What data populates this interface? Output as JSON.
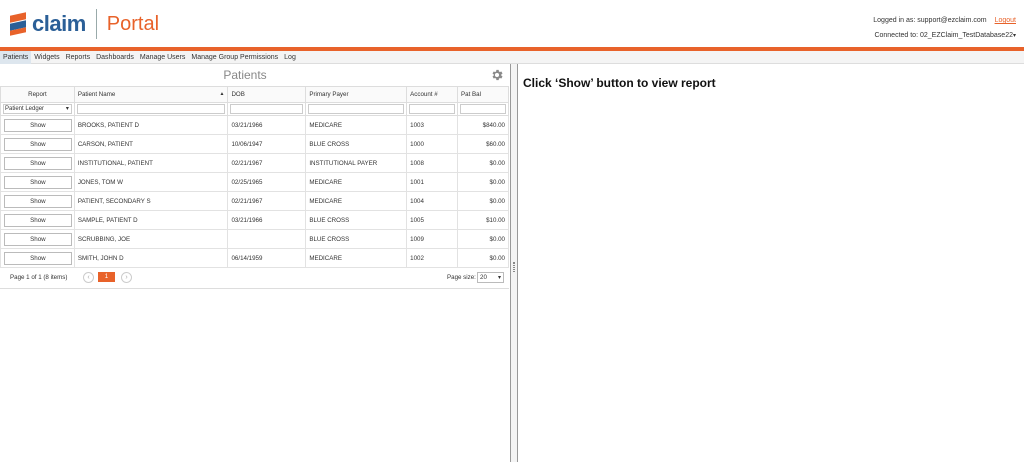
{
  "header": {
    "logo_text": "claim",
    "portal_label": "Portal",
    "logged_in_label": "Logged in as:",
    "logged_in_user": "support@ezclaim.com",
    "logout_label": "Logout",
    "connected_label": "Connected to:",
    "connected_db": "02_EZClaim_TestDatabase22"
  },
  "nav": {
    "items": [
      {
        "label": "Patients"
      },
      {
        "label": "Widgets"
      },
      {
        "label": "Reports"
      },
      {
        "label": "Dashboards"
      },
      {
        "label": "Manage Users"
      },
      {
        "label": "Manage Group Permissions"
      },
      {
        "label": "Log"
      }
    ]
  },
  "patients": {
    "title": "Patients",
    "columns": [
      "Report",
      "Patient Name",
      "DOB",
      "Primary Payer",
      "Account #",
      "Pat Bal"
    ],
    "report_filter": "Patient Ledger",
    "show_label": "Show",
    "rows": [
      {
        "name": "BROOKS, PATIENT D",
        "dob": "03/21/1966",
        "payer": "MEDICARE",
        "account": "1003",
        "bal": "$840.00"
      },
      {
        "name": "CARSON, PATIENT",
        "dob": "10/06/1947",
        "payer": "BLUE CROSS",
        "account": "1000",
        "bal": "$60.00"
      },
      {
        "name": "INSTITUTIONAL, PATIENT",
        "dob": "02/21/1967",
        "payer": "INSTITUTIONAL PAYER",
        "account": "1008",
        "bal": "$0.00"
      },
      {
        "name": "JONES, TOM W",
        "dob": "02/25/1965",
        "payer": "MEDICARE",
        "account": "1001",
        "bal": "$0.00"
      },
      {
        "name": "PATIENT, SECONDARY S",
        "dob": "02/21/1967",
        "payer": "MEDICARE",
        "account": "1004",
        "bal": "$0.00"
      },
      {
        "name": "SAMPLE, PATIENT D",
        "dob": "03/21/1966",
        "payer": "BLUE CROSS",
        "account": "1005",
        "bal": "$10.00"
      },
      {
        "name": "SCRUBBING, JOE",
        "dob": "",
        "payer": "BLUE CROSS",
        "account": "1009",
        "bal": "$0.00"
      },
      {
        "name": "SMITH, JOHN D",
        "dob": "06/14/1959",
        "payer": "MEDICARE",
        "account": "1002",
        "bal": "$0.00"
      }
    ],
    "pager": {
      "info": "Page 1 of 1 (8 items)",
      "current_page": "1",
      "page_size_label": "Page size:",
      "page_size": "20"
    }
  },
  "report": {
    "message": "Click ‘Show’ button to view report"
  },
  "colors": {
    "brand_orange": "#e8622a",
    "brand_blue": "#2b5f97"
  }
}
